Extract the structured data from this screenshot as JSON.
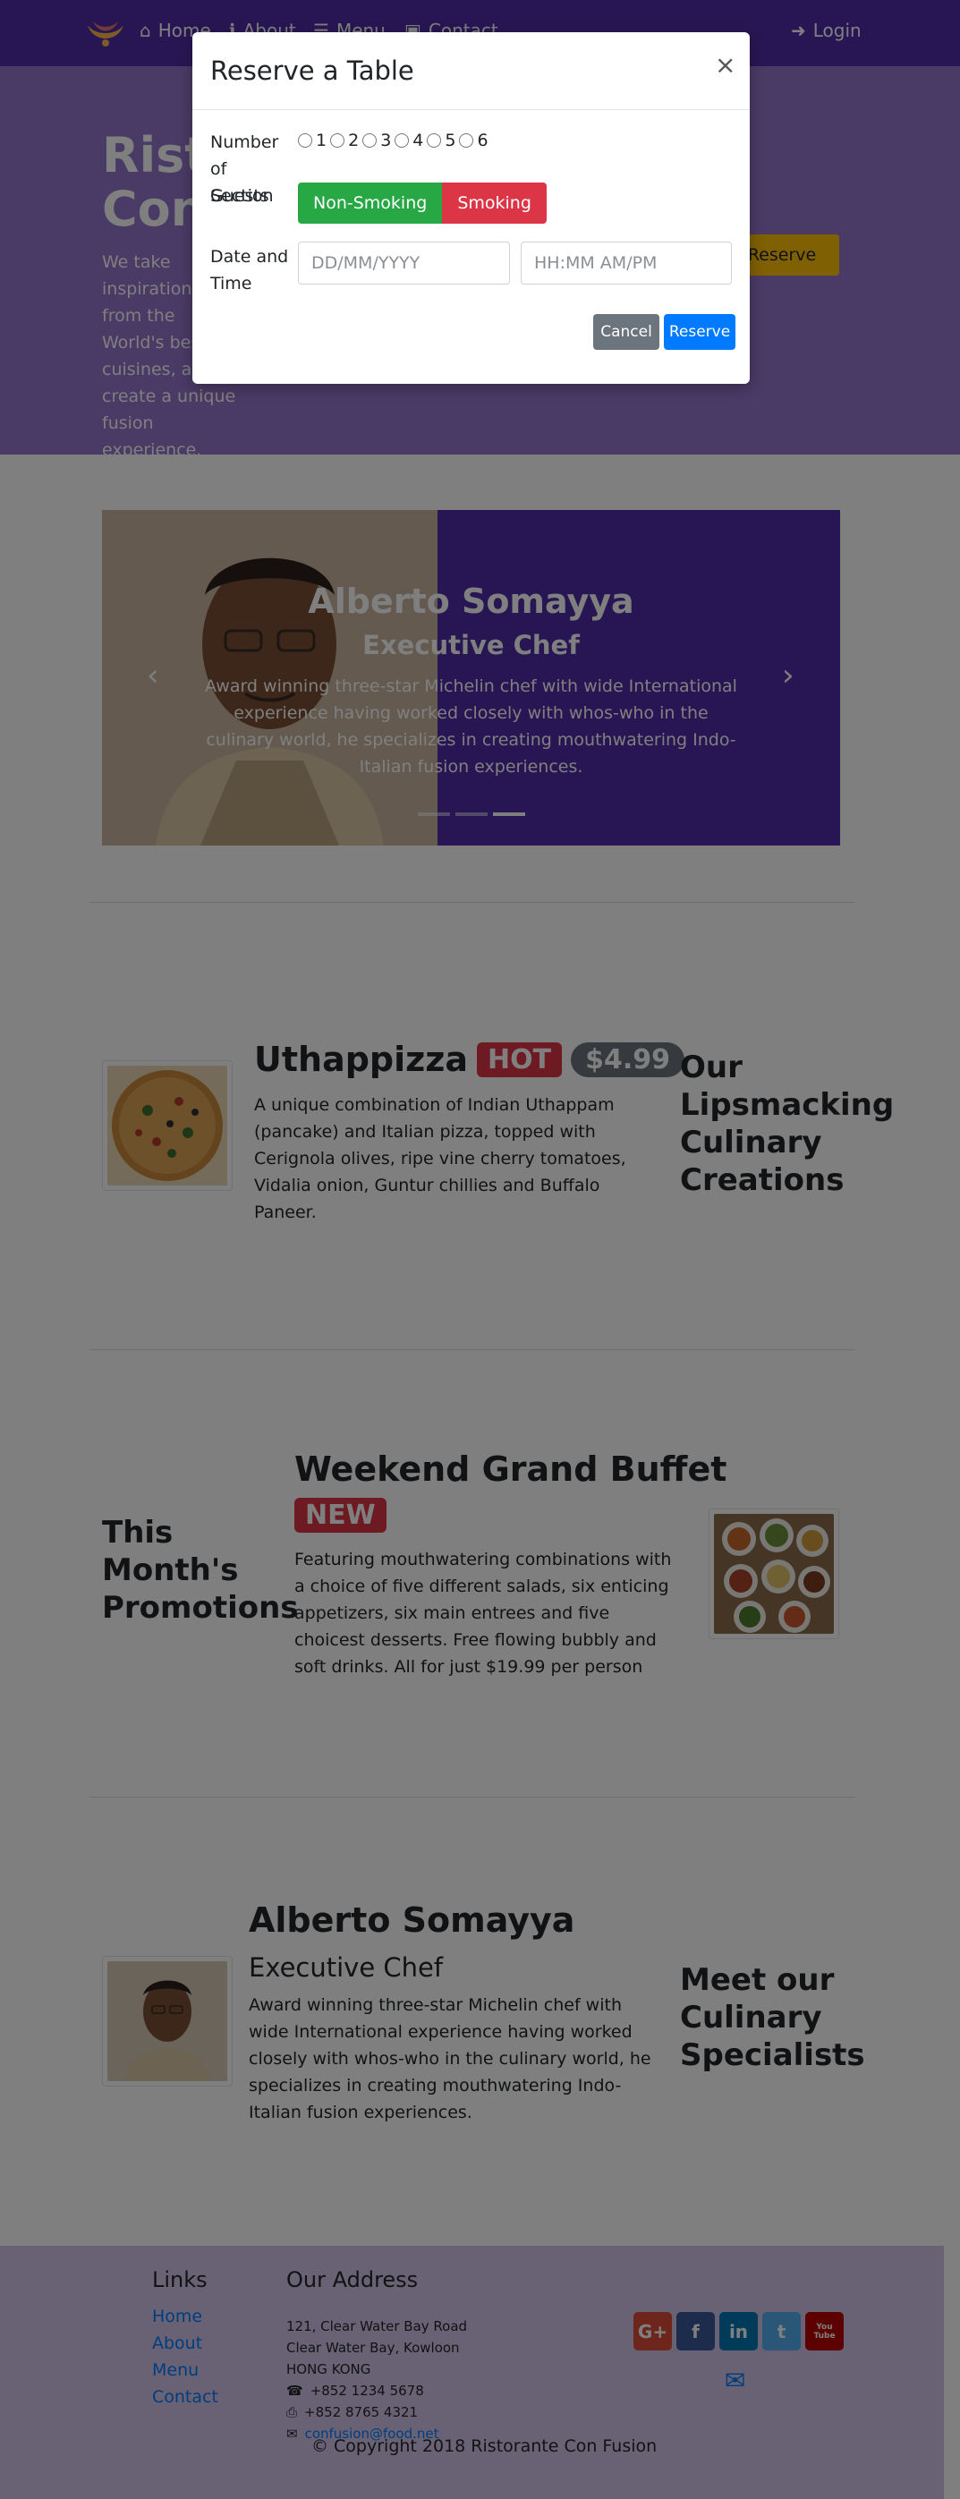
{
  "navbar": {
    "items": [
      "Home",
      "About",
      "Menu",
      "Contact"
    ],
    "login": "Login"
  },
  "jumbotron": {
    "title": "Ristorante Con Fusion",
    "text": "We take inspiration from the World's best cuisines, and create a unique fusion experience. Our lipsmacking creations will tickle your culinary senses!",
    "reserve_button": "Reserve Table"
  },
  "carousel": {
    "name": "Alberto Somayya",
    "role": "Executive Chef",
    "text": "Award winning three-star Michelin chef with wide International experience having worked closely with whos-who in the culinary world, he specializes in creating mouthwatering Indo-Italian fusion experiences.",
    "prev": "‹",
    "next": "›",
    "indicators": 3,
    "active_indicator": 3
  },
  "dish": {
    "title": "Uthappizza",
    "badge": "HOT",
    "price": "$4.99",
    "text": "A unique combination of Indian Uthappam (pancake) and Italian pizza, topped with Cerignola olives, ripe vine cherry tomatoes, Vidalia onion, Guntur chillies and Buffalo Paneer.",
    "side_heading": "Our Lipsmacking Culinary Creations"
  },
  "promotion": {
    "side_heading": "This Month's Promotions",
    "title": "Weekend Grand Buffet",
    "badge": "NEW",
    "text": "Featuring mouthwatering combinations with a choice of five different salads, six enticing appetizers, six main entrees and five choicest desserts. Free flowing bubbly and soft drinks. All for just $19.99 per person"
  },
  "leader": {
    "name": "Alberto Somayya",
    "role": "Executive Chef",
    "text": "Award winning three-star Michelin chef with wide International experience having worked closely with whos-who in the culinary world, he specializes in creating mouthwatering Indo-Italian fusion experiences.",
    "side_heading": "Meet our Culinary Specialists"
  },
  "footer": {
    "links_heading": "Links",
    "links": [
      "Home",
      "About",
      "Menu",
      "Contact"
    ],
    "address_heading": "Our Address",
    "address_lines": [
      "121, Clear Water Bay Road",
      "Clear Water Bay, Kowloon",
      "HONG KONG"
    ],
    "phone": "+852 1234 5678",
    "fax": "+852 8765 4321",
    "email": "confusion@food.net",
    "social": [
      "G+",
      "f",
      "in",
      "t",
      "You Tube"
    ],
    "copyright": "© Copyright 2018 Ristorante Con Fusion"
  },
  "modal": {
    "title": "Reserve a Table",
    "close": "×",
    "guests_label": "Number of Guests",
    "guest_options": [
      "1",
      "2",
      "3",
      "4",
      "5",
      "6"
    ],
    "section_label": "Section",
    "section_options": [
      "Non-Smoking",
      "Smoking"
    ],
    "datetime_label": "Date and Time",
    "date_placeholder": "DD/MM/YYYY",
    "time_placeholder": "HH:MM AM/PM",
    "cancel": "Cancel",
    "reserve": "Reserve"
  },
  "colors": {
    "primary": "#512DA8",
    "jumbotron": "#9575CD",
    "footer": "#D1C4E9",
    "warning": "#FFC107",
    "danger": "#DC3545",
    "success": "#28A745",
    "secondary": "#6C757D",
    "blue": "#007BFF"
  }
}
